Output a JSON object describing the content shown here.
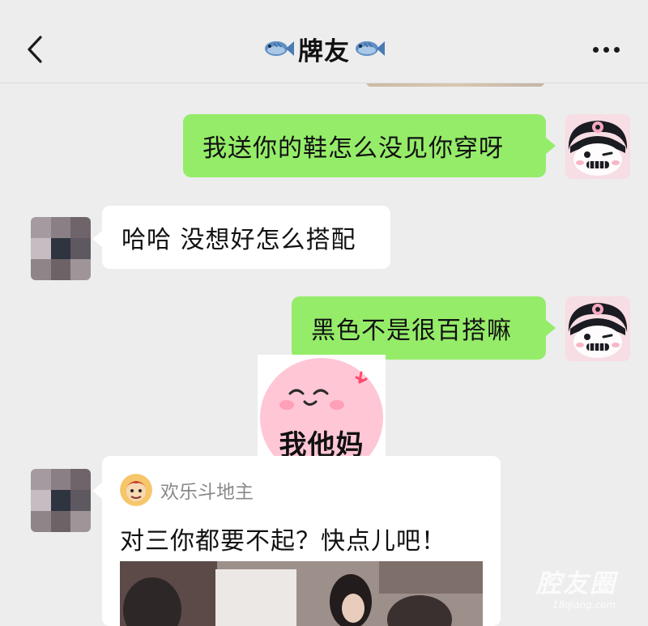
{
  "header": {
    "title": "牌友",
    "back_icon": "chevron-left-icon",
    "more_icon": "ellipsis-icon"
  },
  "messages": [
    {
      "sender": "me",
      "text": "我送你的鞋怎么没见你穿呀"
    },
    {
      "sender": "other",
      "text": "哈哈 没想好怎么搭配"
    },
    {
      "sender": "me",
      "text": "黑色不是很百搭嘛"
    },
    {
      "sender": "me",
      "type": "sticker",
      "text": "我他妈"
    }
  ],
  "shared_card": {
    "app_name": "欢乐斗地主",
    "text": "对三你都要不起？快点儿吧！"
  },
  "watermark": {
    "title": "腔友圈",
    "subtitle": "18qiang.com"
  },
  "colors": {
    "sent_bubble": "#95ec69",
    "received_bubble": "#ffffff",
    "background": "#ededed"
  }
}
